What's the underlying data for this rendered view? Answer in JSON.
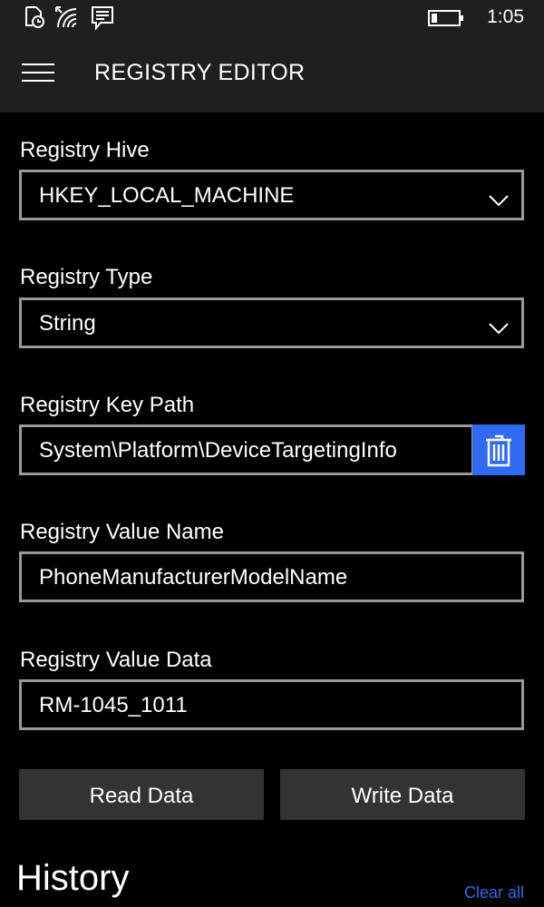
{
  "status_bar": {
    "time": "1:05",
    "icons": [
      "alarm-icon",
      "wifi-icon",
      "message-icon",
      "battery-icon"
    ]
  },
  "app_bar": {
    "title": "REGISTRY EDITOR"
  },
  "form": {
    "hive": {
      "label": "Registry Hive",
      "value": "HKEY_LOCAL_MACHINE"
    },
    "type": {
      "label": "Registry Type",
      "value": "String"
    },
    "key_path": {
      "label": "Registry Key Path",
      "value": "System\\Platform\\DeviceTargetingInfo"
    },
    "value_name": {
      "label": "Registry Value Name",
      "value": "PhoneManufacturerModelName"
    },
    "value_data": {
      "label": "Registry Value Data",
      "value": "RM-1045_1011"
    }
  },
  "buttons": {
    "read_label": "Read Data",
    "write_label": "Write Data"
  },
  "history": {
    "title": "History",
    "clear_label": "Clear all"
  },
  "colors": {
    "accent": "#2e6bf2",
    "bar_background": "#1f1f1f",
    "field_border": "#999999",
    "button_background": "#333333"
  }
}
